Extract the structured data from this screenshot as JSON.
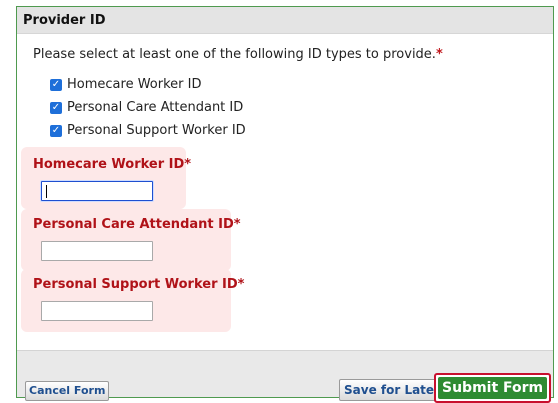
{
  "panel": {
    "title": "Provider ID",
    "intro": "Please select at least one of the following ID types to provide.",
    "required_mark": "*"
  },
  "checkboxes": [
    {
      "label": "Homecare Worker ID",
      "checked": true
    },
    {
      "label": "Personal Care Attendant ID",
      "checked": true
    },
    {
      "label": "Personal Support Worker ID",
      "checked": true
    }
  ],
  "fields": [
    {
      "label": "Homecare Worker ID*",
      "value": "",
      "focused": true
    },
    {
      "label": "Personal Care Attendant ID*",
      "value": ""
    },
    {
      "label": "Personal Support Worker ID*",
      "value": ""
    }
  ],
  "footer": {
    "cancel_label": "Cancel Form",
    "save_label": "Save for Later",
    "submit_label": "Submit Form"
  },
  "colors": {
    "border_green": "#4f9a4f",
    "error_bg": "#fde8e8",
    "error_text": "#b01218",
    "checkbox_blue": "#1e6fd9",
    "submit_green": "#2e8b32",
    "submit_outline": "#c8102e"
  },
  "icons": {
    "checkbox": "checkmark-icon"
  }
}
